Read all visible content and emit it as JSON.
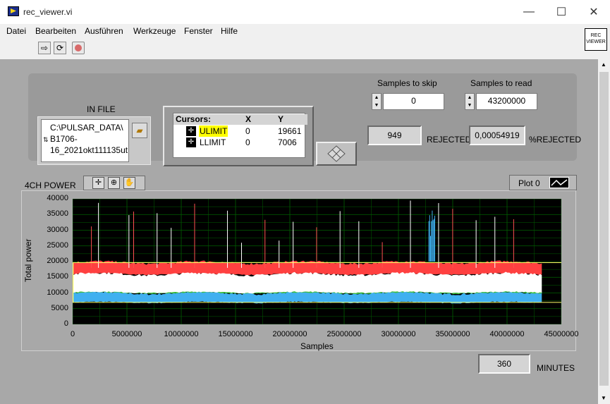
{
  "window": {
    "title": "rec_viewer.vi",
    "minimize": "—",
    "maximize": "☐",
    "close": "✕"
  },
  "menu": [
    "Datei",
    "Bearbeiten",
    "Ausführen",
    "Werkzeuge",
    "Fenster",
    "Hilfe"
  ],
  "toolbar": {
    "run_icon": "run-arrow-icon",
    "run_continuous_icon": "run-continuously-icon",
    "abort_icon": "abort-icon"
  },
  "vi_icon": {
    "line1": "REC",
    "line2": "VIEWER"
  },
  "controls": {
    "in_file_label": "IN FILE",
    "in_file_path": "C:\\PULSAR_DATA\\ B1706- 16_2021okt111135ut",
    "samples_to_skip_label": "Samples to skip",
    "samples_to_skip": "0",
    "samples_to_read_label": "Samples to read",
    "samples_to_read": "43200000",
    "rejected_value": "949",
    "rejected_label": "REJECTED",
    "pct_rejected_value": "0,00054919",
    "pct_rejected_label": "%REJECTED",
    "minutes_value": "360",
    "minutes_label": "MINUTES"
  },
  "cursors": {
    "headers": [
      "Cursors:",
      "X",
      "Y"
    ],
    "rows": [
      {
        "name": "ULIMIT",
        "x": "0",
        "y": "19661"
      },
      {
        "name": "LLIMIT",
        "x": "0",
        "y": "7006"
      }
    ]
  },
  "graph": {
    "label": "4CH POWER",
    "legend_label": "Plot 0"
  },
  "chart_data": {
    "type": "line",
    "xlabel": "Samples",
    "ylabel": "Total power",
    "xlim": [
      0,
      45000000
    ],
    "ylim": [
      0,
      40000
    ],
    "x_ticks": [
      "0",
      "5000000",
      "10000000",
      "15000000",
      "20000000",
      "25000000",
      "30000000",
      "35000000",
      "40000000",
      "45000000"
    ],
    "y_ticks": [
      "0",
      "5000",
      "10000",
      "15000",
      "20000",
      "25000",
      "30000",
      "35000",
      "40000"
    ],
    "grid": true,
    "series": [
      {
        "color": "#ff4040",
        "x_end": 43200000,
        "typical": 18500
      },
      {
        "color": "#ffffff",
        "x_end": 43200000,
        "typical": 17000
      },
      {
        "color": "#40c040",
        "x_end": 43200000,
        "typical": 10000
      },
      {
        "color": "#40b0f0",
        "x_end": 43200000,
        "typical": 8500
      }
    ],
    "cursor_lines": [
      {
        "name": "ULIMIT",
        "y": 19661,
        "color": "#ffff66"
      },
      {
        "name": "LLIMIT",
        "y": 7006,
        "color": "#ffff66"
      }
    ]
  },
  "colors": {
    "panel": "#a8a8a8",
    "plot_bg": "#000000",
    "grid": "#006000",
    "highlight": "#ffff00"
  }
}
